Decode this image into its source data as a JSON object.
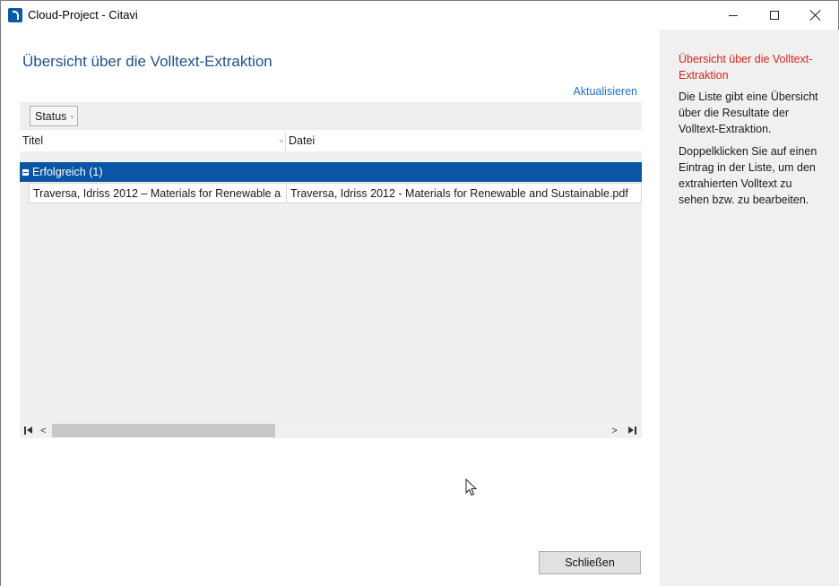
{
  "window": {
    "title": "Cloud-Project - Citavi"
  },
  "main": {
    "page_title": "Übersicht über die Volltext-Extraktion",
    "refresh_label": "Aktualisieren",
    "filter": {
      "status_label": "Status"
    },
    "columns": {
      "title": "Titel",
      "file": "Datei"
    },
    "group": {
      "label": "Erfolgreich (1)"
    },
    "rows": [
      {
        "title": "Traversa, Idriss 2012 – Materials for Renewable a",
        "file": "Traversa, Idriss 2012 - Materials for Renewable and Sustainable.pdf"
      }
    ],
    "close_label": "Schließen"
  },
  "help": {
    "title": "Übersicht über die Volltext-Extraktion",
    "paragraphs": [
      "Die Liste gibt eine Übersicht über die Resultate der Volltext-Extraktion.",
      "Doppelklicken Sie auf einen Eintrag in der Liste, um den extrahierten Volltext zu sehen bzw. zu bearbeiten."
    ]
  },
  "colors": {
    "accent": "#0a56a5",
    "title_blue": "#1f4f8f",
    "link_blue": "#1a73c8",
    "help_title_red": "#d9241d",
    "pane_bg": "#f0f0f0"
  },
  "icons": {
    "app": "citavi-logo-icon",
    "minimize": "minimize-icon",
    "maximize": "maximize-icon",
    "close": "close-icon",
    "filter": "filter-triangle-icon",
    "collapse": "collapse-minus-icon"
  }
}
